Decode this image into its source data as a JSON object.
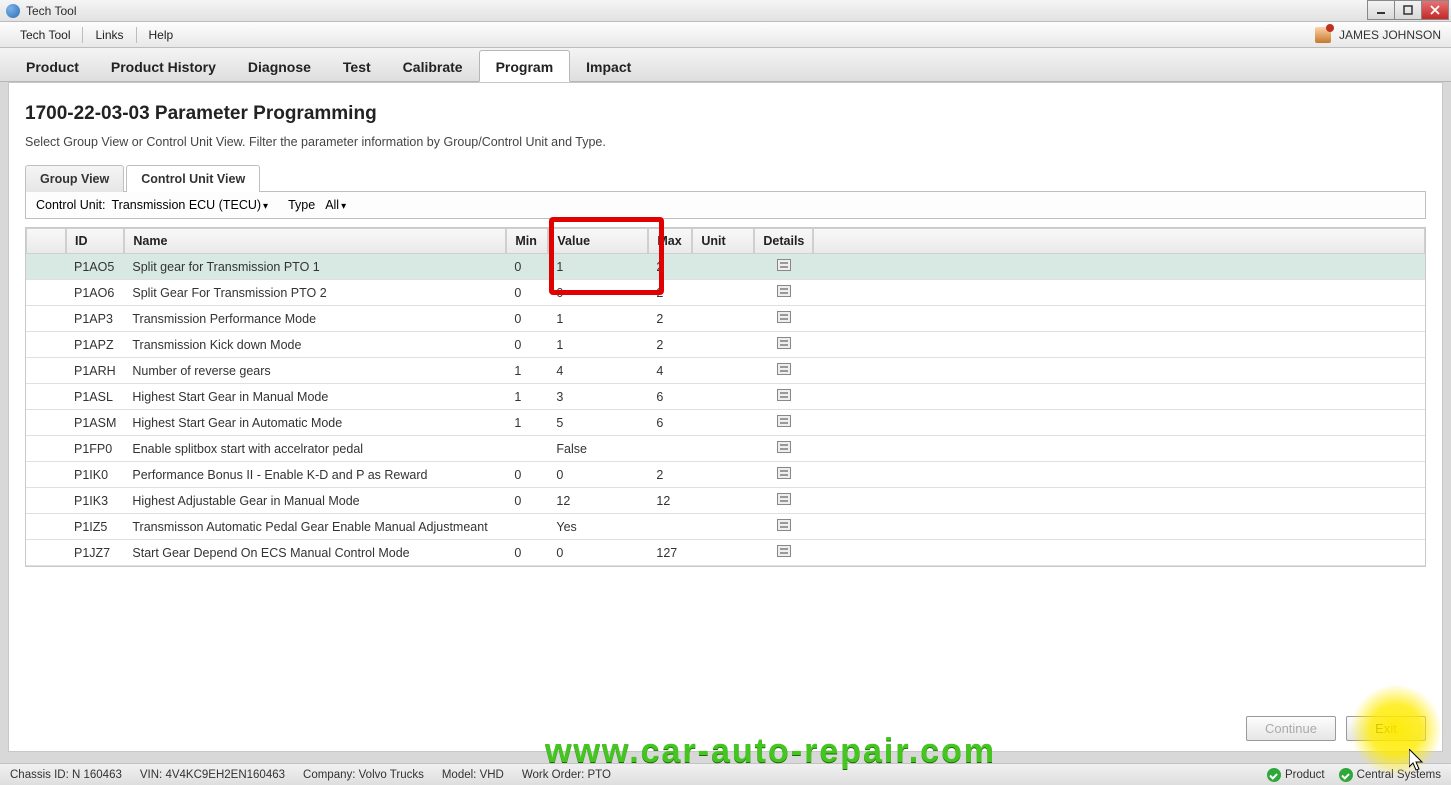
{
  "window": {
    "title": "Tech Tool"
  },
  "menu": {
    "items": [
      "Tech Tool",
      "Links",
      "Help"
    ],
    "user": "JAMES JOHNSON"
  },
  "nav": {
    "items": [
      "Product",
      "Product History",
      "Diagnose",
      "Test",
      "Calibrate",
      "Program",
      "Impact"
    ],
    "active": "Program"
  },
  "page": {
    "title": "1700-22-03-03 Parameter Programming",
    "description": "Select Group View or Control Unit View. Filter the parameter information by Group/Control Unit and Type."
  },
  "views": {
    "tabs": [
      "Group View",
      "Control Unit View"
    ],
    "active": "Control Unit View"
  },
  "filter": {
    "control_unit_label": "Control Unit:",
    "control_unit_value": "Transmission ECU (TECU)",
    "type_label": "Type",
    "type_value": "All"
  },
  "table": {
    "headers": {
      "id": "ID",
      "name": "Name",
      "min": "Min",
      "value": "Value",
      "max": "Max",
      "unit": "Unit",
      "details": "Details"
    },
    "rows": [
      {
        "id": "P1AO5",
        "name": "Split gear for Transmission PTO 1",
        "min": "0",
        "value": "1",
        "max": "2",
        "unit": "",
        "selected": true
      },
      {
        "id": "P1AO6",
        "name": "Split Gear For Transmission PTO 2",
        "min": "0",
        "value": "0",
        "max": "2",
        "unit": ""
      },
      {
        "id": "P1AP3",
        "name": "Transmission Performance Mode",
        "min": "0",
        "value": "1",
        "max": "2",
        "unit": ""
      },
      {
        "id": "P1APZ",
        "name": "Transmission Kick down Mode",
        "min": "0",
        "value": "1",
        "max": "2",
        "unit": ""
      },
      {
        "id": "P1ARH",
        "name": "Number of reverse gears",
        "min": "1",
        "value": "4",
        "max": "4",
        "unit": ""
      },
      {
        "id": "P1ASL",
        "name": "Highest Start Gear in Manual Mode",
        "min": "1",
        "value": "3",
        "max": "6",
        "unit": ""
      },
      {
        "id": "P1ASM",
        "name": "Highest Start Gear in Automatic Mode",
        "min": "1",
        "value": "5",
        "max": "6",
        "unit": ""
      },
      {
        "id": "P1FP0",
        "name": "Enable splitbox start with accelrator pedal",
        "min": "",
        "value": "False",
        "max": "",
        "unit": ""
      },
      {
        "id": "P1IK0",
        "name": "Performance Bonus II - Enable K-D and P as Reward",
        "min": "0",
        "value": "0",
        "max": "2",
        "unit": ""
      },
      {
        "id": "P1IK3",
        "name": "Highest Adjustable Gear in Manual Mode",
        "min": "0",
        "value": "12",
        "max": "12",
        "unit": ""
      },
      {
        "id": "P1IZ5",
        "name": "Transmisson Automatic Pedal Gear   Enable Manual Adjustmeant",
        "min": "",
        "value": "Yes",
        "max": "",
        "unit": ""
      },
      {
        "id": "P1JZ7",
        "name": "Start Gear Depend On ECS Manual Control Mode",
        "min": "0",
        "value": "0",
        "max": "127",
        "unit": ""
      }
    ]
  },
  "actions": {
    "continue": "Continue",
    "exit": "Exit"
  },
  "status": {
    "chassis_label": "Chassis ID:",
    "chassis": "N 160463",
    "vin_label": "VIN:",
    "vin": "4V4KC9EH2EN160463",
    "company_label": "Company:",
    "company": "Volvo Trucks",
    "model_label": "Model:",
    "model": "VHD",
    "work_order_label": "Work Order:",
    "work_order": "PTO",
    "product_label": "Product",
    "central_label": "Central Systems"
  },
  "watermark": "www.car-auto-repair.com"
}
